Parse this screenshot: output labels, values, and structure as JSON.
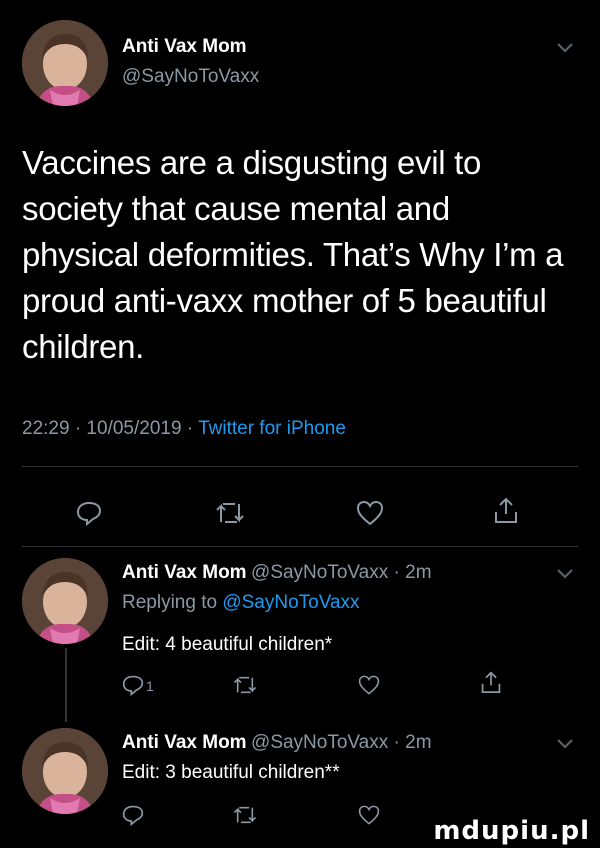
{
  "main_tweet": {
    "author_name": "Anti Vax Mom",
    "author_handle": "@SayNoToVaxx",
    "text_lines": [
      "Vaccines are a disgusting evil to",
      "society that cause mental and",
      "physical deformities. That’s Why I’m a",
      "proud anti-vaxx mother of 5 beautiful",
      "children."
    ],
    "timestamp": "22:29 · 10/05/2019 ·",
    "source": "Twitter for iPhone",
    "menu_icon": "chevron-down-icon"
  },
  "replies": [
    {
      "author_name": "Anti Vax Mom",
      "author_handle": "@SayNoToVaxx · 2m",
      "replying_prefix": "Replying to",
      "replying_to": "@SayNoToVaxx",
      "text": "Edit: 4 beautiful children*",
      "reply_count": "1"
    },
    {
      "author_name": "Anti Vax Mom",
      "author_handle": "@SayNoToVaxx · 2m",
      "text": "Edit: 3 beautiful children**"
    }
  ],
  "watermark": "mdupiu.pl",
  "colors": {
    "background": "#000000",
    "muted": "#8b98a5",
    "link": "#1d9bf0"
  }
}
